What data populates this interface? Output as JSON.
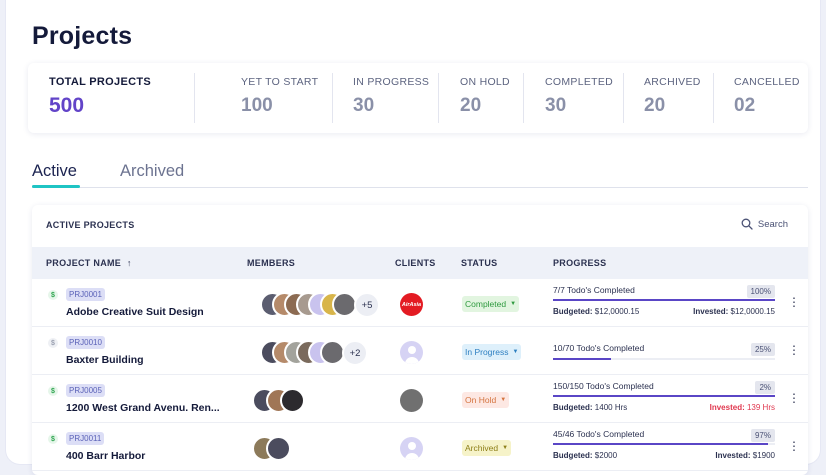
{
  "page": {
    "title": "Projects"
  },
  "stats": [
    {
      "label": "TOTAL PROJECTS",
      "value": "500"
    },
    {
      "label": "YET TO START",
      "value": "100"
    },
    {
      "label": "IN PROGRESS",
      "value": "30"
    },
    {
      "label": "ON HOLD",
      "value": "20"
    },
    {
      "label": "COMPLETED",
      "value": "30"
    },
    {
      "label": "ARCHIVED",
      "value": "20"
    },
    {
      "label": "CANCELLED",
      "value": "02"
    }
  ],
  "tabs": [
    {
      "label": "Active",
      "selected": true
    },
    {
      "label": "Archived",
      "selected": false
    }
  ],
  "table": {
    "title": "ACTIVE PROJECTS",
    "search_label": "Search",
    "columns": {
      "project": "PROJECT NAME",
      "project_sort": "↑",
      "members": "MEMBERS",
      "clients": "CLIENTS",
      "status": "STATUS",
      "progress": "PROGRESS"
    },
    "rows": [
      {
        "id": "PRJ0001",
        "name": "Adobe Creative Suit Design",
        "billable": true,
        "members_extra": "+5",
        "client": "AirAsia",
        "status": "Completed",
        "todo": "7/7 Todo's Completed",
        "percent_label": "100%",
        "progress": 1.0,
        "budgeted_label": "Budgeted:",
        "budgeted": "$12,0000.15",
        "invested_label": "Invested:",
        "invested": "$12,0000.15",
        "invested_over": false
      },
      {
        "id": "PRJ0010",
        "name": "Baxter Building",
        "billable": false,
        "members_extra": "+2",
        "client": "",
        "status": "In Progress",
        "todo": "10/70 Todo's Completed",
        "percent_label": "25%",
        "progress": 0.25,
        "budgeted_label": "",
        "budgeted": "",
        "invested_label": "",
        "invested": "",
        "invested_over": false
      },
      {
        "id": "PRJ0005",
        "name": "1200 West Grand Avenu. Ren...",
        "billable": true,
        "members_extra": "",
        "client": "",
        "status": "On Hold",
        "todo": "150/150 Todo's Completed",
        "percent_label": "2%",
        "progress": 1.0,
        "budgeted_label": "Budgeted:",
        "budgeted": "1400 Hrs",
        "invested_label": "Invested:",
        "invested": "139 Hrs",
        "invested_over": true
      },
      {
        "id": "PRJ0011",
        "name": "400 Barr Harbor",
        "billable": true,
        "members_extra": "",
        "client": "",
        "status": "Archived",
        "todo": "45/46 Todo's Completed",
        "percent_label": "97%",
        "progress": 0.97,
        "budgeted_label": "Budgeted:",
        "budgeted": "$2000",
        "invested_label": "Invested:",
        "invested": "$1900",
        "invested_over": false
      }
    ]
  },
  "colors": {
    "accent": "#6244c8",
    "tab_underline": "#1fc4c4",
    "progress": "#5a46c6",
    "over_budget": "#e0384f",
    "status_completed_bg": "#e2f5e0",
    "status_inprogress_bg": "#def0fb",
    "status_onhold_bg": "#fde8e3",
    "status_archived_bg": "#f6f3c9"
  }
}
